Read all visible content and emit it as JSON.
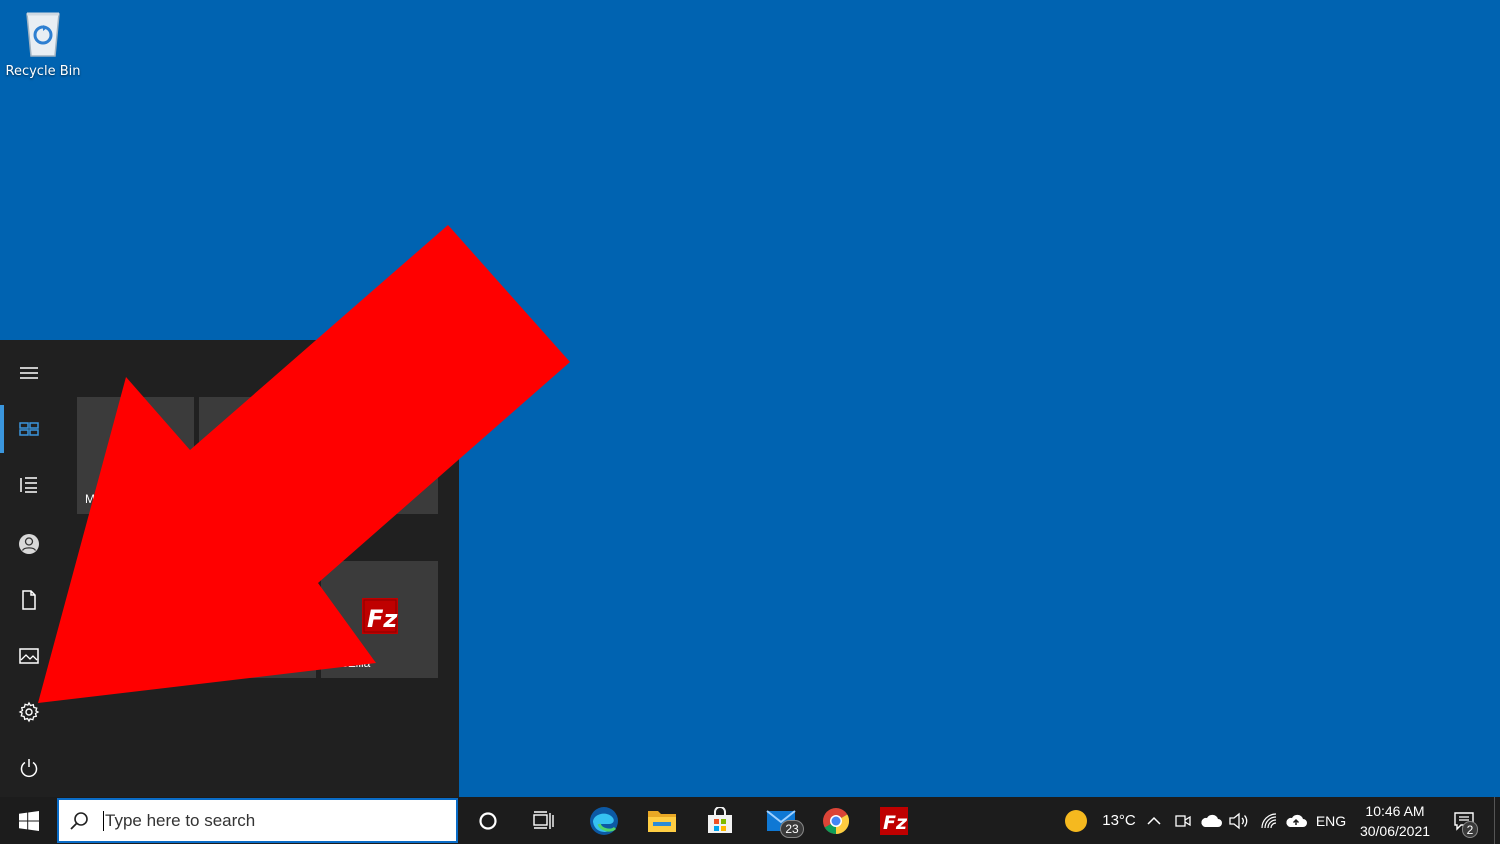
{
  "desktop": {
    "recycle_bin_label": "Recycle Bin"
  },
  "start_menu": {
    "rail_icons": [
      "hamburger-menu-icon",
      "tiles-icon",
      "list-icon",
      "user-icon",
      "documents-icon",
      "pictures-icon",
      "settings-icon",
      "power-icon"
    ],
    "tiles": [
      {
        "label": "M"
      },
      {
        "label": ""
      },
      {
        "label": ""
      },
      {
        "label": "FileZilla"
      }
    ]
  },
  "taskbar": {
    "search_placeholder": "Type here to search",
    "weather_temp": "13°C",
    "language": "ENG",
    "time": "10:46 AM",
    "date": "30/06/2021",
    "mail_badge": "23",
    "notification_badge": "2"
  },
  "colors": {
    "desktop_bg": "#0063b1",
    "start_menu_bg": "#202020",
    "taskbar_bg": "#1c1c1c",
    "arrow": "#ff0000",
    "accent": "#3a96dd"
  }
}
